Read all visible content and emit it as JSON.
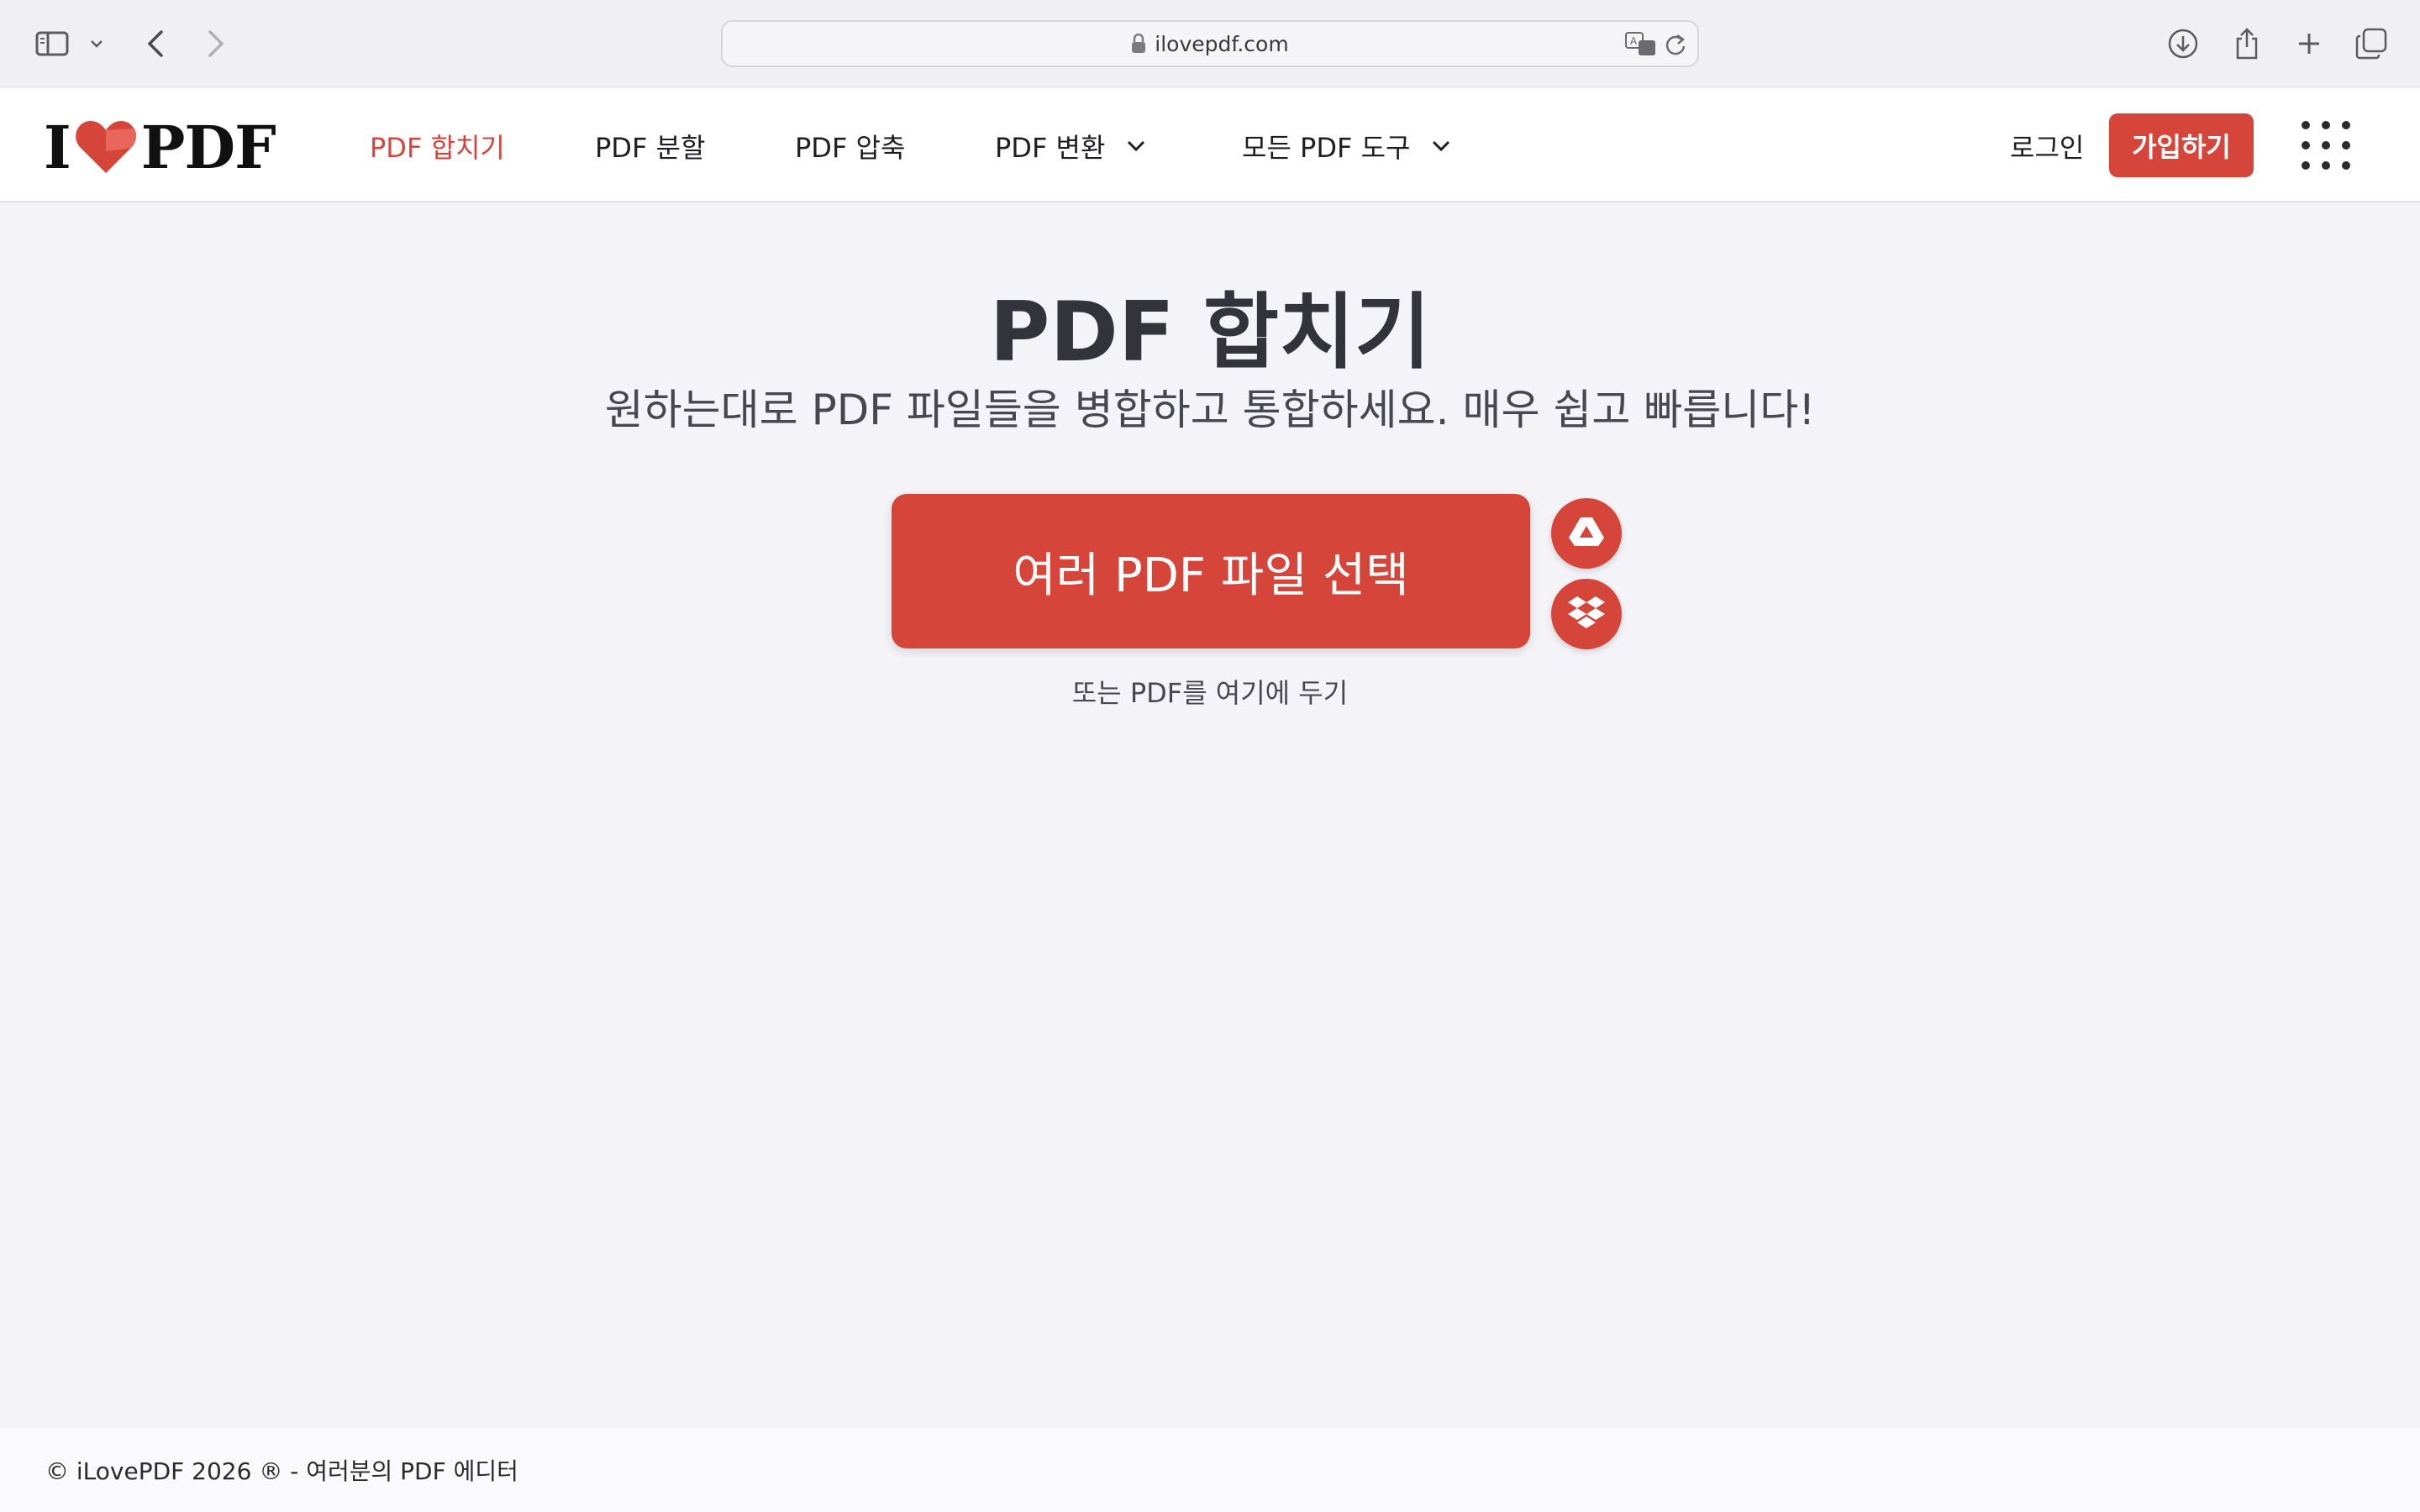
{
  "browser": {
    "url": "ilovepdf.com"
  },
  "site": {
    "logo": {
      "left": "I",
      "right": "PDF"
    },
    "nav": [
      {
        "label": "PDF 합치기",
        "active": true
      },
      {
        "label": "PDF 분할"
      },
      {
        "label": "PDF 압축"
      },
      {
        "label": "PDF 변환",
        "dropdown": true
      },
      {
        "label": "모든 PDF 도구",
        "dropdown": true
      }
    ],
    "login_label": "로그인",
    "signup_label": "가입하기"
  },
  "main": {
    "title": "PDF 합치기",
    "subtitle": "원하는대로 PDF 파일들을 병합하고 통합하세요. 매우 쉽고 빠릅니다!",
    "select_button": "여러 PDF 파일 선택",
    "drop_hint": "또는 PDF를 여기에 두기",
    "cloud_buttons": [
      "google-drive-icon",
      "dropbox-icon"
    ]
  },
  "footer": {
    "text": "© iLovePDF 2026 ® - 여러분의 PDF 에디터"
  },
  "colors": {
    "brand_red": "#d5453a",
    "page_bg": "#f4f3f8"
  }
}
